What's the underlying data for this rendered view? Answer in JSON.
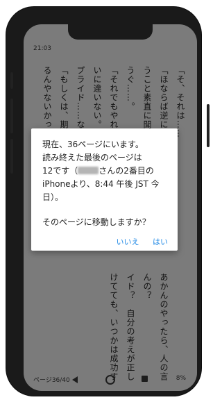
{
  "status": {
    "time": "21:03"
  },
  "reader": {
    "columns": [
      "「そ、それは……",
      "「ほならば逆に聞き",
      "うこと素直に聞い",
      "うぐ……。",
      "「それでもやれへ",
      "いに違いない。い",
      "プライド……な",
      "「もしくは、期待",
      "るんやないかっ"
    ],
    "columns_lower": [
      "あかんのやったら、人の言",
      "んの？",
      "イド？　自分の考えが正し",
      "けてても、いつかは成功す"
    ],
    "page_label": "ページ36/40",
    "percent": "8%"
  },
  "dialog": {
    "line1": "現在、36ページにいます。",
    "line2": "読み終えた最後のページは",
    "line3_before": "12です（",
    "line3_after": "さんの2番目の",
    "line4": "iPhoneより、8:44 午後 JST 今",
    "line5": "日）。",
    "question": "そのページに移動しますか？",
    "no_label": "いいえ",
    "yes_label": "はい",
    "accent_color": "#1e88e5"
  },
  "nav": {
    "back_icon": "triangle-back-icon",
    "home_icon": "circle-home-icon",
    "recent_icon": "square-recent-icon"
  }
}
